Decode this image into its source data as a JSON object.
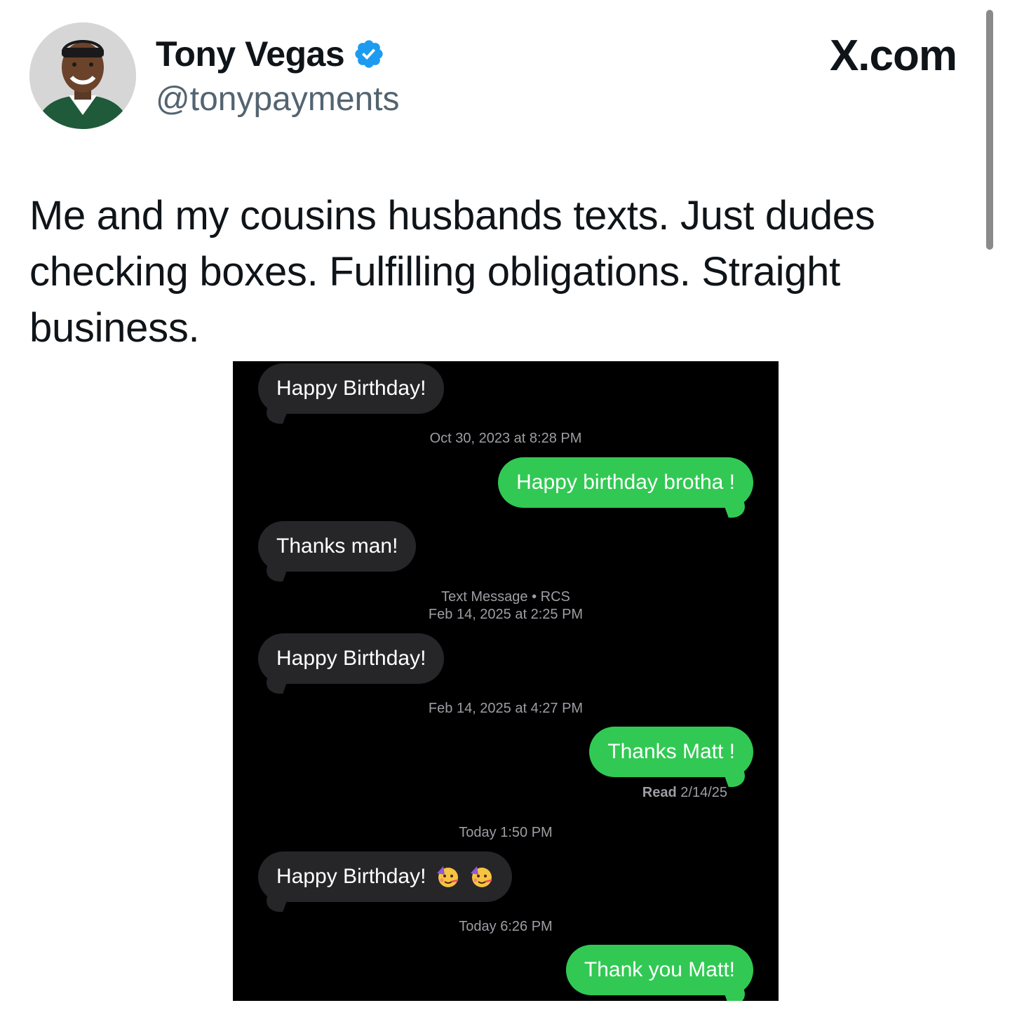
{
  "header": {
    "display_name": "Tony Vegas",
    "handle": "@tonypayments",
    "brand": "X.com"
  },
  "tweet": {
    "text": "Me and my cousins husbands texts. Just dudes checking boxes. Fulfilling obligations. Straight business."
  },
  "colors": {
    "incoming_bubble": "#262629",
    "outgoing_bubble": "#31c953",
    "verified_badge": "#1d9bf0",
    "timestamp_text": "#9d9da4"
  },
  "conversation": {
    "msg1": "Happy Birthday!",
    "ts1": "Oct 30, 2023 at 8:28 PM",
    "msg2": "Happy birthday brotha !",
    "msg3": "Thanks man!",
    "ts2_line1": "Text Message • RCS",
    "ts2_line2": "Feb 14, 2025 at 2:25 PM",
    "msg4": "Happy Birthday!",
    "ts3": "Feb 14, 2025 at 4:27 PM",
    "msg5": "Thanks Matt !",
    "read_label": "Read",
    "read_date": "2/14/25",
    "ts4": "Today 1:50 PM",
    "msg6": "Happy Birthday!",
    "msg6_emoji": "partying-face-icon",
    "ts5": "Today 6:26 PM",
    "msg7": "Thank you Matt!"
  }
}
